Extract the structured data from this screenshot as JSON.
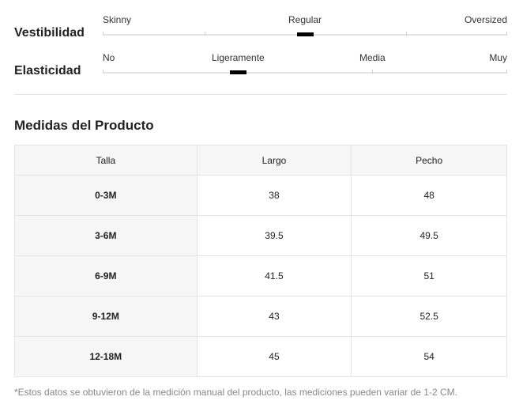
{
  "fit": {
    "label": "Vestibilidad",
    "ticks": [
      "Skinny",
      "Regular",
      "Oversized"
    ],
    "selected": "Regular"
  },
  "elasticity": {
    "label": "Elasticidad",
    "ticks": [
      "No",
      "Ligeramente",
      "Media",
      "Muy"
    ],
    "selected": "Ligeramente"
  },
  "measurements": {
    "title": "Medidas del Producto",
    "columns": [
      "Talla",
      "Largo",
      "Pecho"
    ],
    "rows": [
      {
        "size": "0-3M",
        "length": "38",
        "chest": "48"
      },
      {
        "size": "3-6M",
        "length": "39.5",
        "chest": "49.5"
      },
      {
        "size": "6-9M",
        "length": "41.5",
        "chest": "51"
      },
      {
        "size": "9-12M",
        "length": "43",
        "chest": "52.5"
      },
      {
        "size": "12-18M",
        "length": "45",
        "chest": "54"
      }
    ]
  },
  "footnote": "*Estos datos se obtuvieron de la medición manual del producto, las mediciones pueden variar de 1-2 CM."
}
